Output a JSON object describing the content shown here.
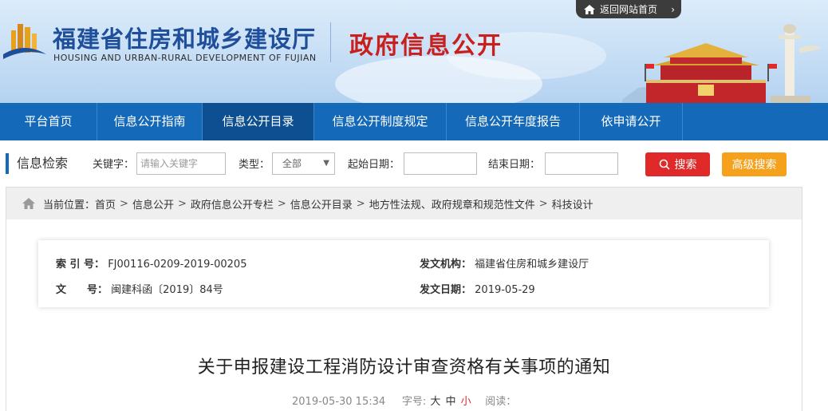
{
  "header": {
    "title_cn": "福建省住房和城乡建设厅",
    "title_en": "HOUSING AND URBAN-RURAL DEVELOPMENT OF FUJIAN",
    "section_title": "政府信息公开",
    "return_link": "返回网站首页"
  },
  "nav": {
    "items": [
      {
        "label": "平台首页"
      },
      {
        "label": "信息公开指南"
      },
      {
        "label": "信息公开目录"
      },
      {
        "label": "信息公开制度规定"
      },
      {
        "label": "信息公开年度报告"
      },
      {
        "label": "依申请公开"
      }
    ],
    "active_index": 2
  },
  "search": {
    "heading": "信息检索",
    "keyword_label": "关键字：",
    "keyword_placeholder": "请输入关键字",
    "type_label": "类型：",
    "type_selected": "全部",
    "start_label": "起始日期：",
    "end_label": "结束日期：",
    "search_button": "搜索",
    "advanced_button": "高级搜索"
  },
  "breadcrumb": {
    "prefix": "当前位置：",
    "items": [
      "首页",
      "信息公开",
      "政府信息公开专栏",
      "信息公开目录",
      "地方性法规、政府规章和规范性文件",
      "科技设计"
    ],
    "separator": ">"
  },
  "meta": {
    "index_label": "索 引 号：",
    "index_value": "FJ00116-0209-2019-00205",
    "issuer_label": "发文机构：",
    "issuer_value": "福建省住房和城乡建设厅",
    "doc_label": "文　　号：",
    "doc_value": "闽建科函〔2019〕84号",
    "date_label": "发文日期：",
    "date_value": "2019-05-29"
  },
  "article": {
    "title": "关于申报建设工程消防设计审查资格有关事项的通知",
    "published": "2019-05-30 15:34",
    "font_label": "字号:",
    "font_large": "大",
    "font_medium": "中",
    "font_small": "小",
    "views_label": "阅读："
  },
  "colors": {
    "nav_blue": "#1469b8",
    "nav_active": "#0d4f91",
    "title_blue": "#1f4f9a",
    "section_red": "#c8201d",
    "search_red": "#e02a2a",
    "advanced_orange": "#f5a11c"
  }
}
